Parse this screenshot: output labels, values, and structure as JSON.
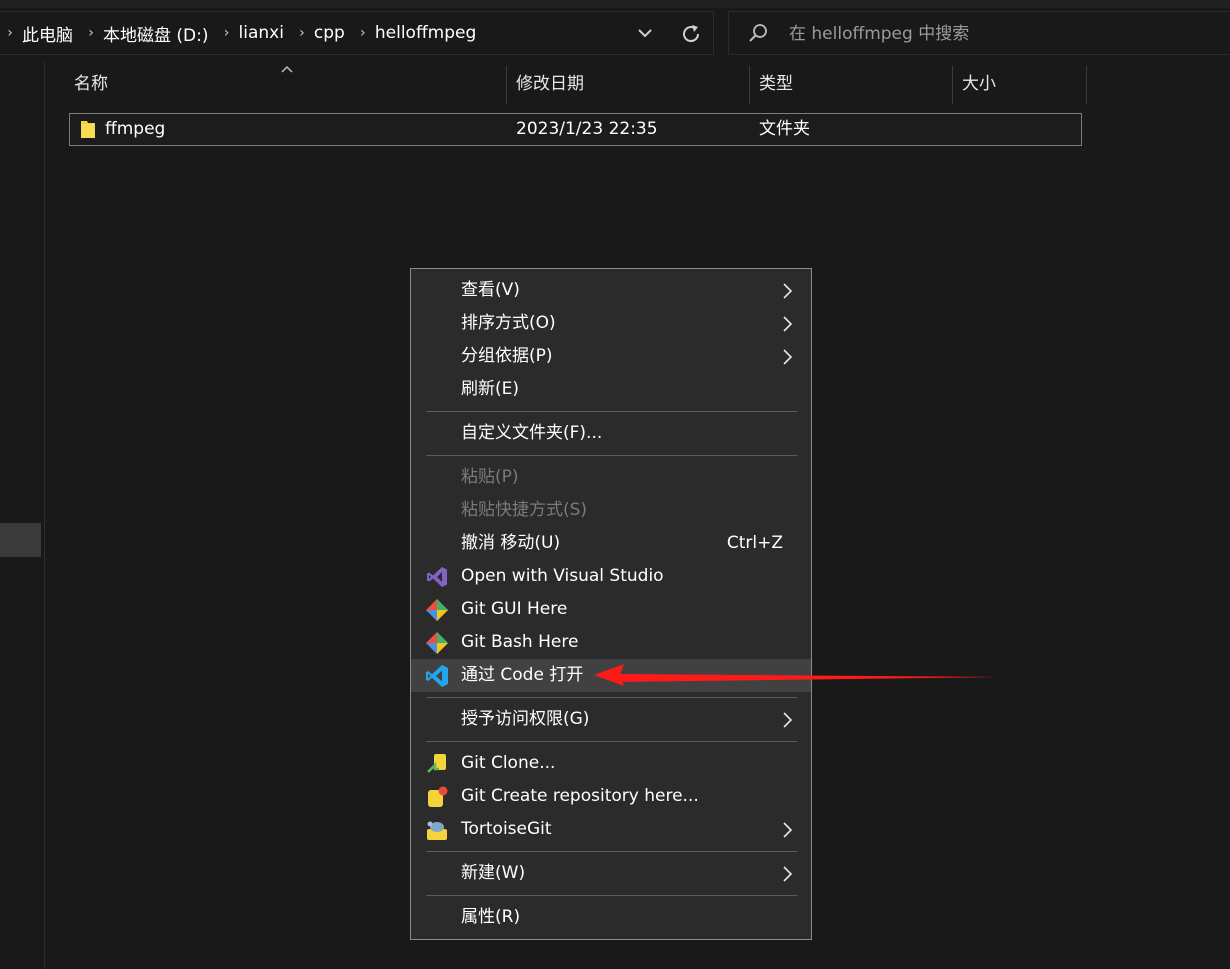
{
  "breadcrumb": [
    "此电脑",
    "本地磁盘 (D:)",
    "lianxi",
    "cpp",
    "helloffmpeg"
  ],
  "search": {
    "placeholder": "在 helloffmpeg 中搜索"
  },
  "columns": {
    "name": "名称",
    "date": "修改日期",
    "type": "类型",
    "size": "大小"
  },
  "files": [
    {
      "name": "ffmpeg",
      "date": "2023/1/23 22:35",
      "type": "文件夹",
      "size": ""
    }
  ],
  "menu": {
    "view": "查看(V)",
    "sort": "排序方式(O)",
    "group": "分组依据(P)",
    "refresh": "刷新(E)",
    "customize": "自定义文件夹(F)...",
    "paste": "粘贴(P)",
    "paste_shortcut": "粘贴快捷方式(S)",
    "undo": "撤消 移动(U)",
    "undo_shortcut": "Ctrl+Z",
    "open_vs": "Open with Visual Studio",
    "git_gui": "Git GUI Here",
    "git_bash": "Git Bash Here",
    "open_code": "通过 Code 打开",
    "grant_access": "授予访问权限(G)",
    "git_clone": "Git Clone...",
    "git_create": "Git Create repository here...",
    "tortoise": "TortoiseGit",
    "new": "新建(W)",
    "properties": "属性(R)"
  },
  "colors": {
    "background": "#191919",
    "menu_bg": "#2b2b2b",
    "menu_hover": "#414141",
    "folder": "#f5d33b",
    "vs_purple": "#8661c5",
    "vscode_blue": "#23a5f0",
    "annotation_red": "#ff1a1a"
  },
  "icons": {
    "folder": "folder-icon",
    "visual_studio": "visual-studio-icon",
    "git": "git-icon",
    "vscode": "vscode-icon",
    "git_clone": "git-clone-icon",
    "git_create": "git-create-icon",
    "tortoise": "tortoisegit-icon",
    "search": "search-icon",
    "refresh": "refresh-icon"
  }
}
